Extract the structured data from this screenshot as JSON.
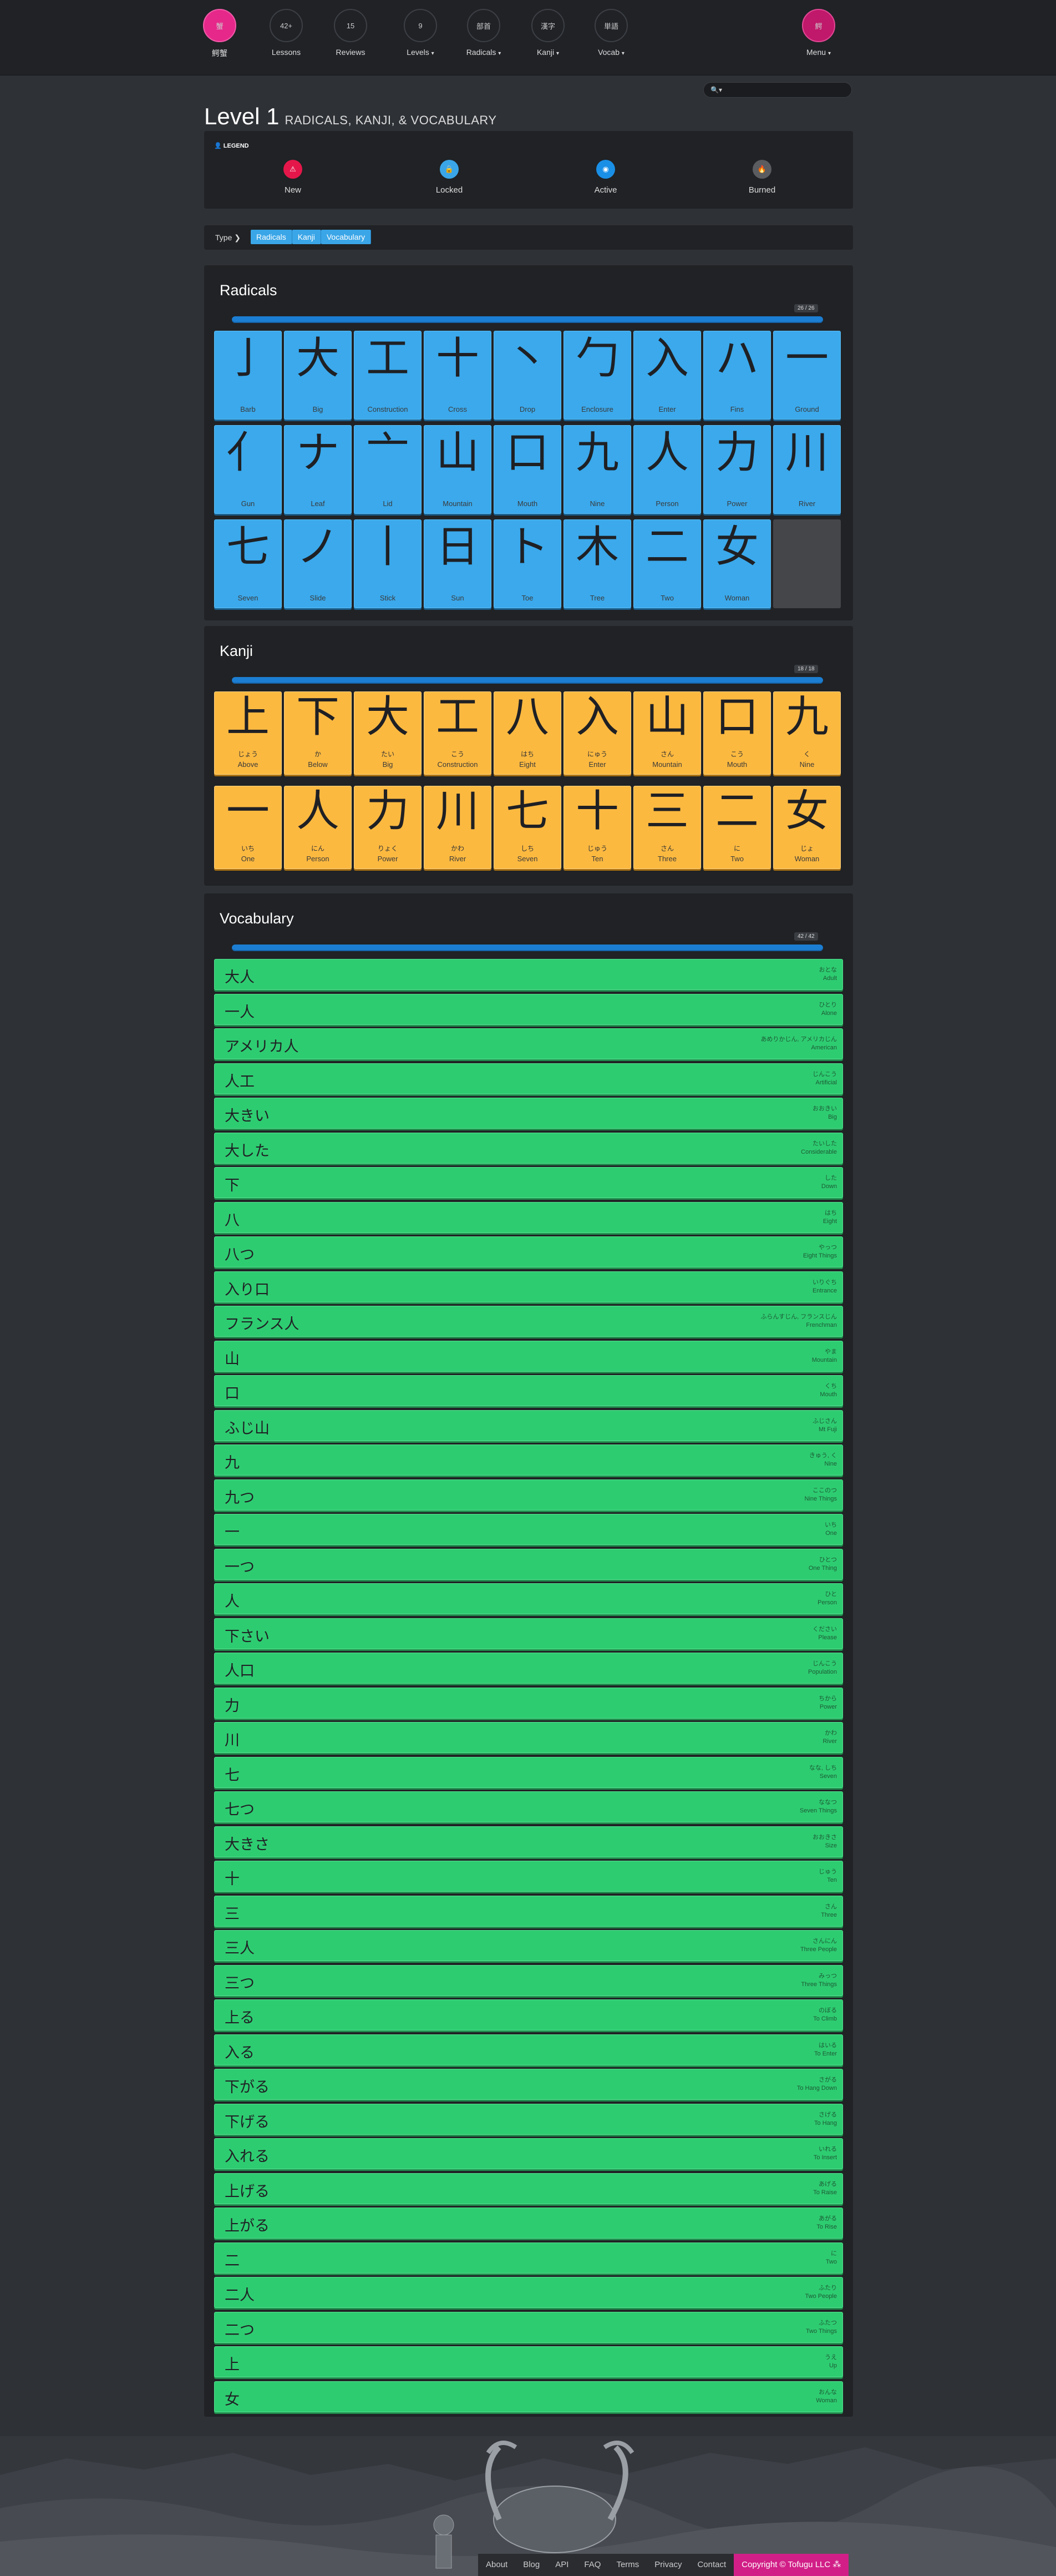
{
  "nav": {
    "logo_label": "鰐蟹",
    "logo_glyph": "蟹",
    "items": [
      {
        "count": "42+",
        "label": "Lessons",
        "caret": ""
      },
      {
        "count": "15",
        "label": "Reviews",
        "caret": ""
      },
      {
        "count": "9",
        "label": "Levels",
        "caret": "▾"
      },
      {
        "count": "部首",
        "label": "Radicals",
        "caret": "▾"
      },
      {
        "count": "漢字",
        "label": "Kanji",
        "caret": "▾"
      },
      {
        "count": "単語",
        "label": "Vocab",
        "caret": "▾"
      }
    ],
    "menu_label": "Menu",
    "menu_glyph": "鰐",
    "menu_caret": "▾"
  },
  "search": {
    "placeholder": "🔍▾"
  },
  "page": {
    "level": "Level 1",
    "subtitle": "RADICALS, KANJI, & VOCABULARY"
  },
  "legend": {
    "title": "LEGEND",
    "items": [
      {
        "label": "New",
        "icon": "new-icon",
        "color": "#e5174a"
      },
      {
        "label": "Locked",
        "icon": "lock-icon",
        "color": "#3aa6e8"
      },
      {
        "label": "Active",
        "icon": "active-icon",
        "color": "#1a8fe6"
      },
      {
        "label": "Burned",
        "icon": "burned-icon",
        "color": "#5a5c60"
      }
    ]
  },
  "typebar": {
    "label": "Type",
    "buttons": [
      "Radicals",
      "Kanji",
      "Vocabulary"
    ]
  },
  "radicals": {
    "title": "Radicals",
    "count": "26 / 26",
    "items": [
      {
        "ch": "亅",
        "m": "Barb"
      },
      {
        "ch": "大",
        "m": "Big"
      },
      {
        "ch": "工",
        "m": "Construction"
      },
      {
        "ch": "十",
        "m": "Cross"
      },
      {
        "ch": "丶",
        "m": "Drop"
      },
      {
        "ch": "勹",
        "m": "Enclosure"
      },
      {
        "ch": "入",
        "m": "Enter"
      },
      {
        "ch": "ハ",
        "m": "Fins"
      },
      {
        "ch": "一",
        "m": "Ground"
      },
      {
        "ch": "⺅",
        "m": "Gun"
      },
      {
        "ch": "ナ",
        "m": "Leaf"
      },
      {
        "ch": "亠",
        "m": "Lid"
      },
      {
        "ch": "山",
        "m": "Mountain"
      },
      {
        "ch": "口",
        "m": "Mouth"
      },
      {
        "ch": "九",
        "m": "Nine"
      },
      {
        "ch": "人",
        "m": "Person"
      },
      {
        "ch": "力",
        "m": "Power"
      },
      {
        "ch": "川",
        "m": "River"
      },
      {
        "ch": "七",
        "m": "Seven"
      },
      {
        "ch": "ノ",
        "m": "Slide"
      },
      {
        "ch": "丨",
        "m": "Stick"
      },
      {
        "ch": "日",
        "m": "Sun"
      },
      {
        "ch": "ト",
        "m": "Toe"
      },
      {
        "ch": "木",
        "m": "Tree"
      },
      {
        "ch": "二",
        "m": "Two"
      },
      {
        "ch": "女",
        "m": "Woman"
      }
    ]
  },
  "kanji": {
    "title": "Kanji",
    "count": "18 / 18",
    "items": [
      {
        "ch": "上",
        "r": "じょう",
        "m": "Above"
      },
      {
        "ch": "下",
        "r": "か",
        "m": "Below"
      },
      {
        "ch": "大",
        "r": "たい",
        "m": "Big"
      },
      {
        "ch": "工",
        "r": "こう",
        "m": "Construction"
      },
      {
        "ch": "八",
        "r": "はち",
        "m": "Eight"
      },
      {
        "ch": "入",
        "r": "にゅう",
        "m": "Enter"
      },
      {
        "ch": "山",
        "r": "さん",
        "m": "Mountain"
      },
      {
        "ch": "口",
        "r": "こう",
        "m": "Mouth"
      },
      {
        "ch": "九",
        "r": "く",
        "m": "Nine"
      },
      {
        "ch": "一",
        "r": "いち",
        "m": "One"
      },
      {
        "ch": "人",
        "r": "にん",
        "m": "Person"
      },
      {
        "ch": "力",
        "r": "りょく",
        "m": "Power"
      },
      {
        "ch": "川",
        "r": "かわ",
        "m": "River"
      },
      {
        "ch": "七",
        "r": "しち",
        "m": "Seven"
      },
      {
        "ch": "十",
        "r": "じゅう",
        "m": "Ten"
      },
      {
        "ch": "三",
        "r": "さん",
        "m": "Three"
      },
      {
        "ch": "二",
        "r": "に",
        "m": "Two"
      },
      {
        "ch": "女",
        "r": "じょ",
        "m": "Woman"
      }
    ]
  },
  "vocab": {
    "title": "Vocabulary",
    "count": "42 / 42",
    "items": [
      {
        "w": "大人",
        "r": "おとな",
        "m": "Adult"
      },
      {
        "w": "一人",
        "r": "ひとり",
        "m": "Alone"
      },
      {
        "w": "アメリカ人",
        "r": "あめりかじん, アメリカじん",
        "m": "American"
      },
      {
        "w": "人工",
        "r": "じんこう",
        "m": "Artificial"
      },
      {
        "w": "大きい",
        "r": "おおきい",
        "m": "Big"
      },
      {
        "w": "大した",
        "r": "たいした",
        "m": "Considerable"
      },
      {
        "w": "下",
        "r": "した",
        "m": "Down"
      },
      {
        "w": "八",
        "r": "はち",
        "m": "Eight"
      },
      {
        "w": "八つ",
        "r": "やっつ",
        "m": "Eight Things"
      },
      {
        "w": "入り口",
        "r": "いりぐち",
        "m": "Entrance"
      },
      {
        "w": "フランス人",
        "r": "ふらんすじん, フランスじん",
        "m": "Frenchman"
      },
      {
        "w": "山",
        "r": "やま",
        "m": "Mountain"
      },
      {
        "w": "口",
        "r": "くち",
        "m": "Mouth"
      },
      {
        "w": "ふじ山",
        "r": "ふじさん",
        "m": "Mt Fuji"
      },
      {
        "w": "九",
        "r": "きゅう, く",
        "m": "Nine"
      },
      {
        "w": "九つ",
        "r": "ここのつ",
        "m": "Nine Things"
      },
      {
        "w": "一",
        "r": "いち",
        "m": "One"
      },
      {
        "w": "一つ",
        "r": "ひとつ",
        "m": "One Thing"
      },
      {
        "w": "人",
        "r": "ひと",
        "m": "Person"
      },
      {
        "w": "下さい",
        "r": "ください",
        "m": "Please"
      },
      {
        "w": "人口",
        "r": "じんこう",
        "m": "Population"
      },
      {
        "w": "力",
        "r": "ちから",
        "m": "Power"
      },
      {
        "w": "川",
        "r": "かわ",
        "m": "River"
      },
      {
        "w": "七",
        "r": "なな, しち",
        "m": "Seven"
      },
      {
        "w": "七つ",
        "r": "ななつ",
        "m": "Seven Things"
      },
      {
        "w": "大きさ",
        "r": "おおきさ",
        "m": "Size"
      },
      {
        "w": "十",
        "r": "じゅう",
        "m": "Ten"
      },
      {
        "w": "三",
        "r": "さん",
        "m": "Three"
      },
      {
        "w": "三人",
        "r": "さんにん",
        "m": "Three People"
      },
      {
        "w": "三つ",
        "r": "みっつ",
        "m": "Three Things"
      },
      {
        "w": "上る",
        "r": "のぼる",
        "m": "To Climb"
      },
      {
        "w": "入る",
        "r": "はいる",
        "m": "To Enter"
      },
      {
        "w": "下がる",
        "r": "さがる",
        "m": "To Hang Down"
      },
      {
        "w": "下げる",
        "r": "さげる",
        "m": "To Hang"
      },
      {
        "w": "入れる",
        "r": "いれる",
        "m": "To Insert"
      },
      {
        "w": "上げる",
        "r": "あげる",
        "m": "To Raise"
      },
      {
        "w": "上がる",
        "r": "あがる",
        "m": "To Rise"
      },
      {
        "w": "二",
        "r": "に",
        "m": "Two"
      },
      {
        "w": "二人",
        "r": "ふたり",
        "m": "Two People"
      },
      {
        "w": "二つ",
        "r": "ふたつ",
        "m": "Two Things"
      },
      {
        "w": "上",
        "r": "うえ",
        "m": "Up"
      },
      {
        "w": "女",
        "r": "おんな",
        "m": "Woman"
      }
    ]
  },
  "footer": {
    "links": [
      "About",
      "Blog",
      "API",
      "FAQ",
      "Terms",
      "Privacy",
      "Contact"
    ],
    "copyright": "Copyright © Tofugu LLC ⁂"
  }
}
